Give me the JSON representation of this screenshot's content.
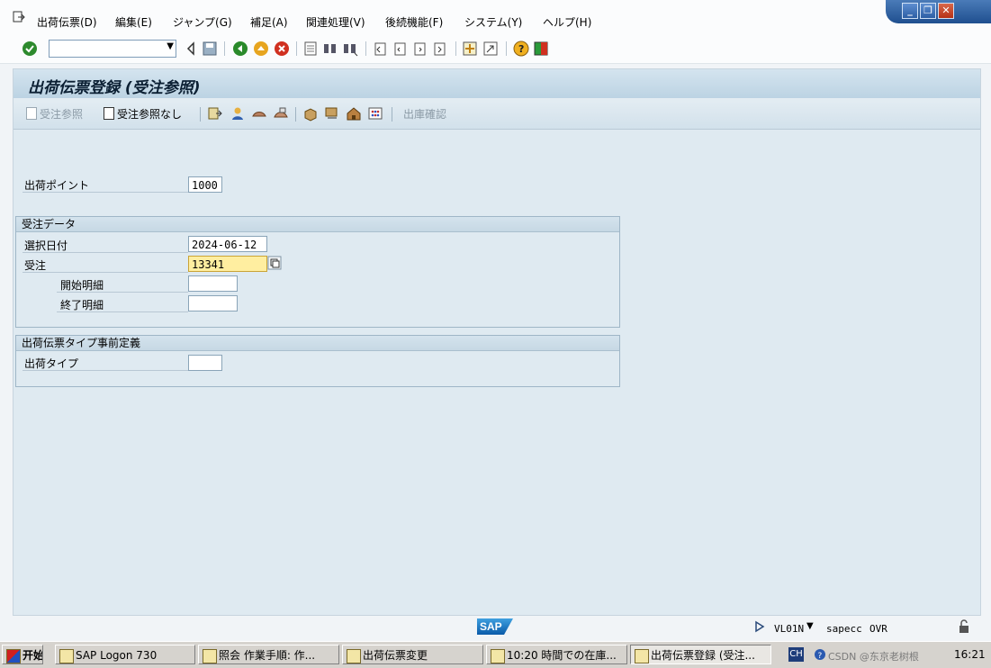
{
  "menubar": {
    "items": [
      "出荷伝票(D)",
      "編集(E)",
      "ジャンプ(G)",
      "補足(A)",
      "関連処理(V)",
      "後続機能(F)",
      "システム(Y)",
      "ヘルプ(H)"
    ]
  },
  "window_controls": {
    "minimize": "_",
    "restore": "❐",
    "close": "✕"
  },
  "system_toolbar": {
    "command_field_value": ""
  },
  "screen": {
    "title": "出荷伝票登録 (受注参照)"
  },
  "app_toolbar": {
    "btn_ref_order": "受注参照",
    "btn_no_ref_order": "受注参照なし",
    "btn_goods_issue": "出庫確認"
  },
  "form": {
    "shipping_point_label": "出荷ポイント",
    "shipping_point_value": "1000",
    "group_order_title": "受注データ",
    "selection_date_label": "選択日付",
    "selection_date_value": "2024-06-12",
    "order_label": "受注",
    "order_value": "13341",
    "from_item_label": "開始明細",
    "from_item_value": "",
    "to_item_label": "終了明細",
    "to_item_value": "",
    "group_delivery_type_title": "出荷伝票タイプ事前定義",
    "delivery_type_label": "出荷タイプ",
    "delivery_type_value": ""
  },
  "statusbar": {
    "sap_logo": "SAP",
    "transaction": "VL01N",
    "system": "sapecc",
    "mode": "OVR"
  },
  "taskbar": {
    "start": "开始",
    "tasks": [
      "SAP Logon 730",
      "照会 作業手順: 作...",
      "出荷伝票変更",
      "10:20 時間での在庫...",
      "出荷伝票登録 (受注..."
    ],
    "lang": "CH",
    "clock": "16:21",
    "watermark": "CSDN @东京老树根"
  }
}
